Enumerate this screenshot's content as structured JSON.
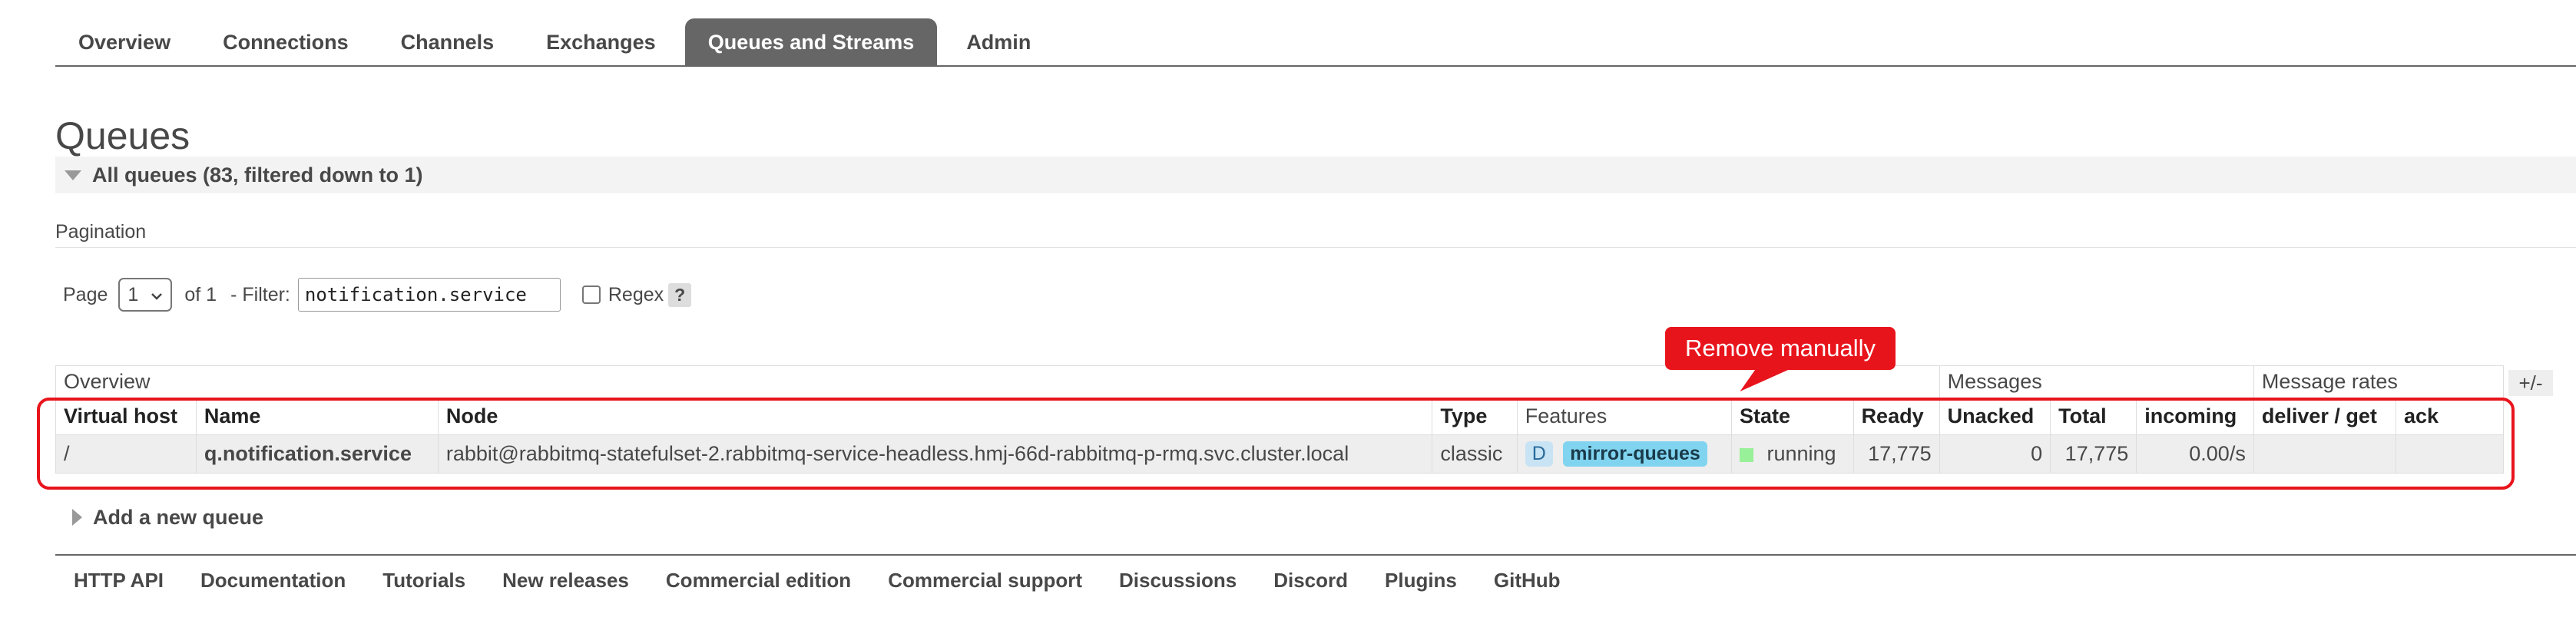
{
  "nav": {
    "tabs": [
      "Overview",
      "Connections",
      "Channels",
      "Exchanges",
      "Queues and Streams",
      "Admin"
    ],
    "active": "Queues and Streams"
  },
  "page_title": "Queues",
  "all_queues_label": "All queues (83, filtered down to 1)",
  "pagination": {
    "label": "Pagination",
    "page_label": "Page",
    "page_value": "1",
    "of_label": "of 1",
    "filter_label": "- Filter:",
    "filter_value": "notification.service",
    "regex_label": "Regex",
    "help_label": "?"
  },
  "table": {
    "groups": {
      "overview": "Overview",
      "messages": "Messages",
      "message_rates": "Message rates"
    },
    "headers": {
      "virtual_host": "Virtual host",
      "name": "Name",
      "node": "Node",
      "type": "Type",
      "features": "Features",
      "state": "State",
      "ready": "Ready",
      "unacked": "Unacked",
      "total": "Total",
      "incoming": "incoming",
      "deliver_get": "deliver / get",
      "ack": "ack"
    },
    "row": {
      "virtual_host": "/",
      "name": "q.notification.service",
      "node": "rabbit@rabbitmq-statefulset-2.rabbitmq-service-headless.hmj-66d-rabbitmq-p-rmq.svc.cluster.local",
      "type": "classic",
      "feature_d": "D",
      "feature_policy": "mirror-queues",
      "state": "running",
      "ready": "17,775",
      "unacked": "0",
      "total": "17,775",
      "incoming": "0.00/s",
      "deliver_get": "",
      "ack": ""
    },
    "columns_toggle": "+/-"
  },
  "annotation": {
    "callout_text": "Remove manually",
    "color": "#e8141c"
  },
  "add_queue_label": "Add a new queue",
  "footer": {
    "links": [
      "HTTP API",
      "Documentation",
      "Tutorials",
      "New releases",
      "Commercial edition",
      "Commercial support",
      "Discussions",
      "Discord",
      "Plugins",
      "GitHub"
    ]
  },
  "colors": {
    "active_tab_bg": "#666666",
    "row_bg": "#eeeeee",
    "state_running": "#98f098",
    "feature_policy_bg": "#80d4f0"
  }
}
